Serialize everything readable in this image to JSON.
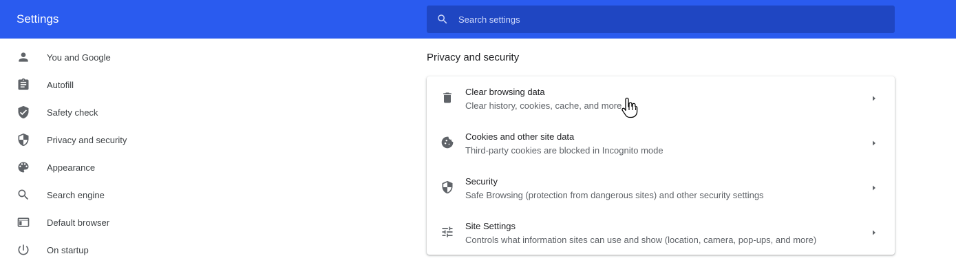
{
  "header": {
    "title": "Settings",
    "search_placeholder": "Search settings"
  },
  "sidebar": {
    "items": [
      {
        "label": "You and Google",
        "icon": "person-icon"
      },
      {
        "label": "Autofill",
        "icon": "clipboard-icon"
      },
      {
        "label": "Safety check",
        "icon": "shield-check-icon"
      },
      {
        "label": "Privacy and security",
        "icon": "shield-icon"
      },
      {
        "label": "Appearance",
        "icon": "palette-icon"
      },
      {
        "label": "Search engine",
        "icon": "search-icon"
      },
      {
        "label": "Default browser",
        "icon": "browser-window-icon"
      },
      {
        "label": "On startup",
        "icon": "power-icon"
      }
    ]
  },
  "main": {
    "section_title": "Privacy and security",
    "rows": [
      {
        "title": "Clear browsing data",
        "subtitle": "Clear history, cookies, cache, and more",
        "icon": "trash-icon"
      },
      {
        "title": "Cookies and other site data",
        "subtitle": "Third-party cookies are blocked in Incognito mode",
        "icon": "cookie-icon"
      },
      {
        "title": "Security",
        "subtitle": "Safe Browsing (protection from dangerous sites) and other security settings",
        "icon": "shield-icon"
      },
      {
        "title": "Site Settings",
        "subtitle": "Controls what information sites can use and show (location, camera, pop-ups, and more)",
        "icon": "tune-icon"
      }
    ]
  },
  "colors": {
    "header_bg": "#2a5bef",
    "search_bg": "#1f46c2",
    "icon_gray": "#5f6368",
    "text_dark": "#202124"
  }
}
